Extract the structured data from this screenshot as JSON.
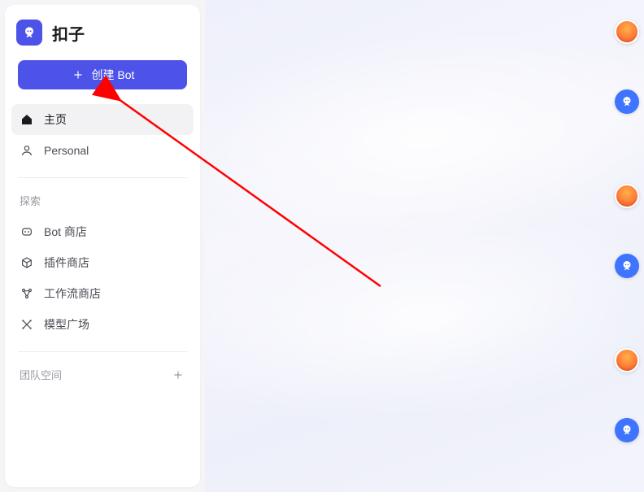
{
  "brand": {
    "name": "扣子"
  },
  "create_button": {
    "label": "创建 Bot"
  },
  "nav_primary": {
    "home": {
      "label": "主页"
    },
    "personal": {
      "label": "Personal"
    }
  },
  "explore": {
    "title": "探索",
    "items": {
      "bot_store": {
        "label": "Bot 商店"
      },
      "plugin_store": {
        "label": "插件商店"
      },
      "workflow_store": {
        "label": "工作流商店"
      },
      "model_plaza": {
        "label": "模型广场"
      }
    }
  },
  "team_space": {
    "label": "团队空间"
  },
  "dock": {
    "items": [
      {
        "name": "balloon-avatar"
      },
      {
        "name": "bot-avatar"
      },
      {
        "name": "balloon-avatar"
      },
      {
        "name": "bot-avatar"
      },
      {
        "name": "balloon-avatar"
      },
      {
        "name": "bot-avatar"
      }
    ]
  },
  "colors": {
    "accent": "#4D53E8",
    "dock_bot": "#3e74ff",
    "annotation_arrow": "#ff0000"
  }
}
